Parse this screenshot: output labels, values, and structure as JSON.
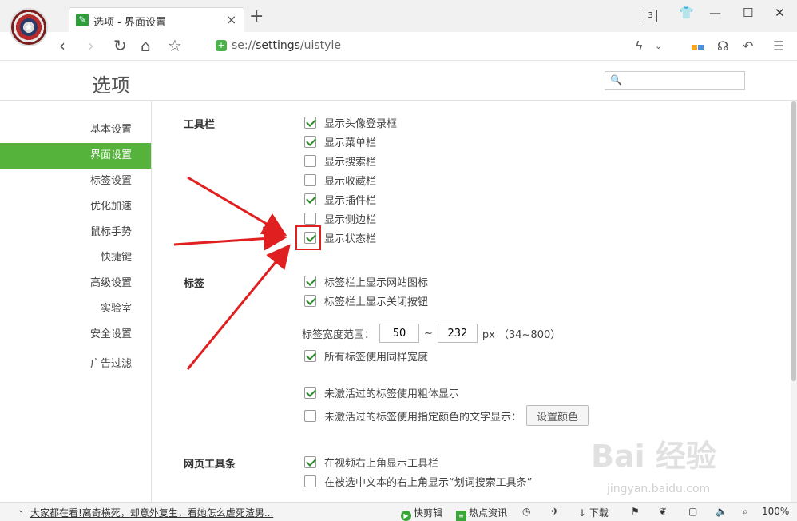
{
  "tab": {
    "title": "选项 - 界面设置"
  },
  "titlebar": {
    "tab_count": "3"
  },
  "address": {
    "scheme": "se://",
    "host": "settings",
    "path": "/uistyle"
  },
  "page": {
    "title": "选项",
    "search_placeholder": ""
  },
  "sidebar": {
    "items": [
      {
        "label": "基本设置",
        "active": false
      },
      {
        "label": "界面设置",
        "active": true
      },
      {
        "label": "标签设置",
        "active": false
      },
      {
        "label": "优化加速",
        "active": false
      },
      {
        "label": "鼠标手势",
        "active": false
      },
      {
        "label": "快捷键",
        "active": false
      },
      {
        "label": "高级设置",
        "active": false
      },
      {
        "label": "实验室",
        "active": false
      },
      {
        "label": "安全设置",
        "active": false
      },
      {
        "label": "广告过滤",
        "active": false
      }
    ]
  },
  "sections": {
    "toolbar": {
      "title": "工具栏",
      "options": [
        {
          "label": "显示头像登录框",
          "checked": true
        },
        {
          "label": "显示菜单栏",
          "checked": true
        },
        {
          "label": "显示搜索栏",
          "checked": false
        },
        {
          "label": "显示收藏栏",
          "checked": false
        },
        {
          "label": "显示插件栏",
          "checked": true
        },
        {
          "label": "显示侧边栏",
          "checked": false
        },
        {
          "label": "显示状态栏",
          "checked": true
        }
      ]
    },
    "tabs": {
      "title": "标签",
      "options": [
        {
          "label": "标签栏上显示网站图标",
          "checked": true
        },
        {
          "label": "标签栏上显示关闭按钮",
          "checked": true
        }
      ],
      "width_label": "标签宽度范围：",
      "width_min": "50",
      "width_sep": "~",
      "width_max": "232",
      "width_unit": "px （34~800）",
      "same_width": {
        "label": "所有标签使用同样宽度",
        "checked": true
      },
      "bold_inactive": {
        "label": "未激活过的标签使用粗体显示",
        "checked": true
      },
      "color_inactive": {
        "label": "未激活过的标签使用指定颜色的文字显示：",
        "checked": false
      },
      "set_color_button": "设置颜色"
    },
    "web_toolbar": {
      "title": "网页工具条",
      "options": [
        {
          "label": "在视频右上角显示工具栏",
          "checked": true
        },
        {
          "label": "在被选中文本的右上角显示“划词搜索工具条”",
          "checked": false
        }
      ]
    }
  },
  "statusbar": {
    "news": "大家都在看!离奇横死，却意外复生，看她怎么虐死渣男...",
    "clip": "快剪辑",
    "hot": "热点资讯",
    "download": "下载",
    "zoom": "100%"
  },
  "watermark": {
    "main": "Bai 经验",
    "sub": "jingyan.baidu.com"
  },
  "colors": {
    "accent": "#55b33b",
    "arrow": "#e02020"
  }
}
